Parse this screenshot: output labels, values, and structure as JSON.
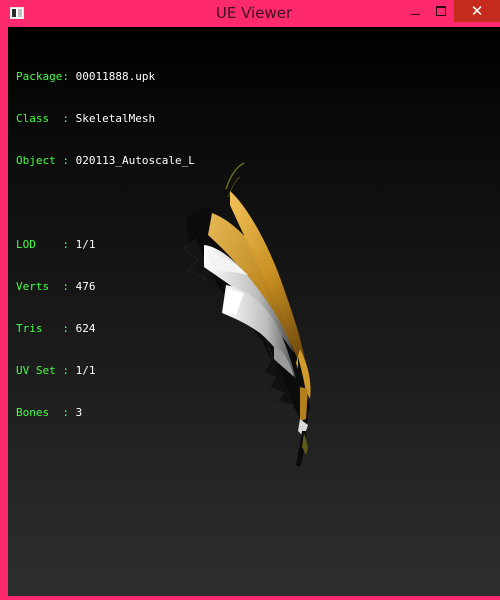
{
  "window": {
    "title": "UE Viewer",
    "controls": {
      "minimize": "",
      "maximize": "",
      "close": "✕"
    }
  },
  "info": {
    "package": {
      "label": "Package:",
      "value": "00011888.upk"
    },
    "class": {
      "label": "Class  :",
      "value": "SkeletalMesh"
    },
    "object": {
      "label": "Object :",
      "value": "020113_Autoscale_L"
    },
    "lod": {
      "label": "LOD    :",
      "value": "1/1"
    },
    "verts": {
      "label": "Verts  :",
      "value": "476"
    },
    "tris": {
      "label": "Tris   :",
      "value": "624"
    },
    "uvset": {
      "label": "UV Set :",
      "value": "1/1"
    },
    "bones": {
      "label": "Bones  :",
      "value": "3"
    }
  },
  "colors": {
    "frame": "#ff2a6e",
    "label_text": "#43ff43",
    "value_text": "#ffffff",
    "close_hover": "#c42b1c"
  }
}
